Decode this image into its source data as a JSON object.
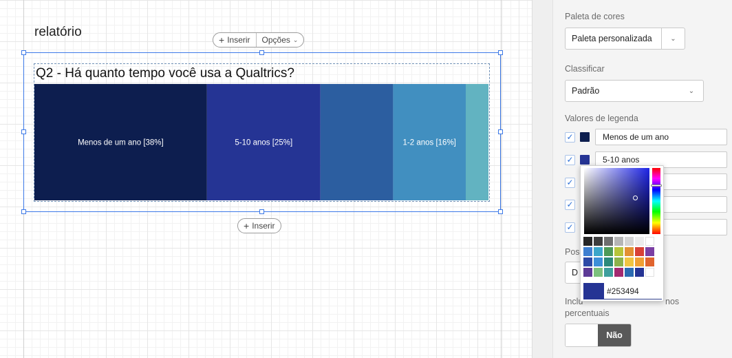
{
  "report": {
    "title": "relatório",
    "insert_label": "Inserir",
    "options_label": "Opções",
    "insert_below_label": "Inserir"
  },
  "chart_data": {
    "type": "bar",
    "title": "Q2 - Há quanto tempo você usa a Qualtrics?",
    "categories": [
      "Menos de um ano",
      "5-10 anos",
      "",
      "1-2 anos",
      ""
    ],
    "values": [
      38,
      25,
      16,
      16,
      6
    ],
    "labels": [
      "Menos de um ano [38%]",
      "5-10 anos [25%]",
      "",
      "1-2 anos [16%]",
      ""
    ],
    "colors": [
      "#0d1e4f",
      "#253494",
      "#2c5ea0",
      "#418fc0",
      "#62b3c1"
    ],
    "xlim": [
      0,
      100
    ]
  },
  "panel": {
    "palette_label": "Paleta de cores",
    "palette_value": "Paleta personalizada",
    "sort_label": "Classificar",
    "sort_value": "Padrão",
    "legend_label": "Valores de legenda",
    "legend_items": [
      {
        "label": "Menos de um ano",
        "color": "#0d1e4f",
        "checked": true
      },
      {
        "label": "5-10 anos",
        "color": "#253494",
        "checked": true
      },
      {
        "label": "",
        "color": "#2c5ea0",
        "checked": true
      },
      {
        "label": "",
        "color": "#418fc0",
        "checked": true
      },
      {
        "label": "",
        "color": "#62b3c1",
        "checked": true
      }
    ],
    "position_label_partial": "Pos",
    "position_value_partial": "D",
    "include_label_line1_start": "Inclu",
    "include_label_line1_end": "nos",
    "include_label_line2": "percentuais",
    "toggle_value": "Não"
  },
  "color_picker": {
    "hex_value": "#253494",
    "swatches": [
      "#262626",
      "#3d3d3d",
      "#6e6e6e",
      "#b5b5b5",
      "#d4d4d4",
      "#ececec",
      "#ffffff",
      "#3e7fd0",
      "#3ba6c9",
      "#4e9a57",
      "#b7c43a",
      "#e39032",
      "#d84136",
      "#7b3fa3",
      "#2d4aa6",
      "#3d8fd8",
      "#2c8a7a",
      "#8db24b",
      "#f0c542",
      "#f0a034",
      "#e0642e",
      "#5d3a96",
      "#7cc07d",
      "#3e9f9d",
      "#a32a70",
      "#2b6bb2",
      "#253494",
      "#ffffff"
    ]
  }
}
